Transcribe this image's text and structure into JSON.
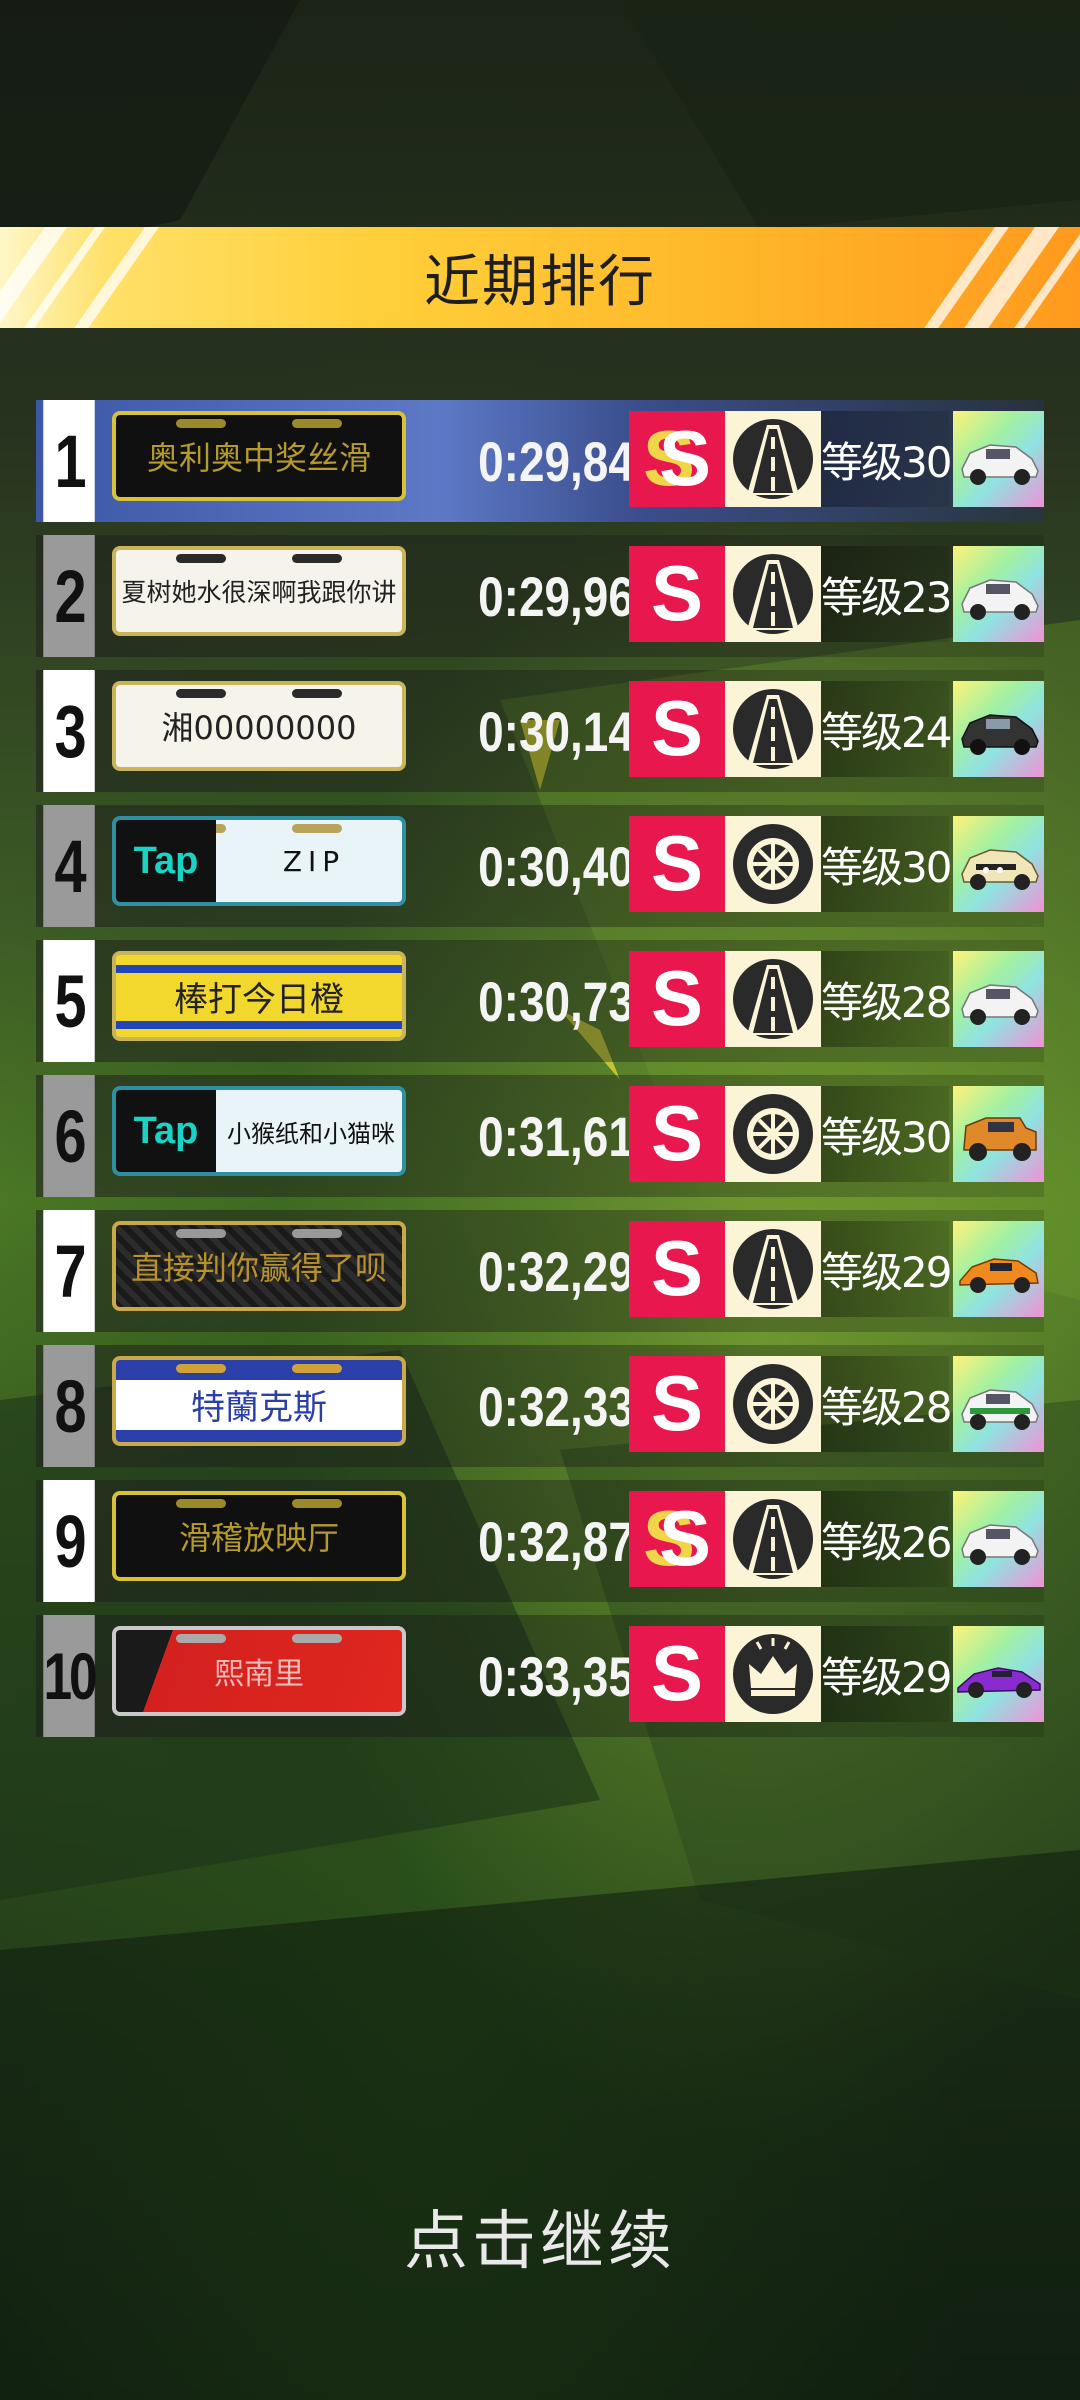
{
  "header": {
    "title": "近期排行"
  },
  "rows": [
    {
      "rank": "1",
      "plate": "奥利奥中奖丝滑",
      "time": "0:29,84",
      "level": "等级30",
      "mode_icon": "road-icon",
      "badge": "gold-s",
      "car": "white-sedan"
    },
    {
      "rank": "2",
      "plate": "夏树她水很深啊我跟你讲",
      "time": "0:29,96",
      "level": "等级23",
      "mode_icon": "road-icon",
      "badge": "s",
      "car": "white-sedan"
    },
    {
      "rank": "3",
      "plate": "湘00000000",
      "time": "0:30,14",
      "level": "等级24",
      "mode_icon": "road-icon",
      "badge": "s",
      "car": "dark-sedan"
    },
    {
      "rank": "4",
      "plate_brand": "Tap",
      "plate": "ZIP",
      "time": "0:30,40",
      "level": "等级30",
      "mode_icon": "tire-icon",
      "badge": "s",
      "car": "rally-car"
    },
    {
      "rank": "5",
      "plate": "棒打今日橙",
      "time": "0:30,73",
      "level": "等级28",
      "mode_icon": "road-icon",
      "badge": "s",
      "car": "white-sedan"
    },
    {
      "rank": "6",
      "plate_brand": "Tap",
      "plate": "小猴纸和小猫咪",
      "time": "0:31,61",
      "level": "等级30",
      "mode_icon": "tire-icon",
      "badge": "s",
      "car": "jeep"
    },
    {
      "rank": "7",
      "plate": "直接判你赢得了呗",
      "time": "0:32,29",
      "level": "等级29",
      "mode_icon": "road-icon",
      "badge": "s",
      "car": "orange-coupe"
    },
    {
      "rank": "8",
      "plate": "特蘭克斯",
      "time": "0:32,33",
      "level": "等级28",
      "mode_icon": "tire-icon",
      "badge": "s",
      "car": "livery-sedan"
    },
    {
      "rank": "9",
      "plate": "滑稽放映厅",
      "time": "0:32,87",
      "level": "等级26",
      "mode_icon": "road-icon",
      "badge": "gold-s",
      "car": "white-sedan"
    },
    {
      "rank": "10",
      "plate": "熙南里",
      "time": "0:33,35",
      "level": "等级29",
      "mode_icon": "crown-icon",
      "badge": "s",
      "car": "purple-hypercar"
    }
  ],
  "footer": {
    "continue_label": "点击继续"
  },
  "colors": {
    "badge_red": "#e8174e",
    "banner_gold": "#ffcf3a",
    "first_row_blue": "#4a66b5"
  }
}
